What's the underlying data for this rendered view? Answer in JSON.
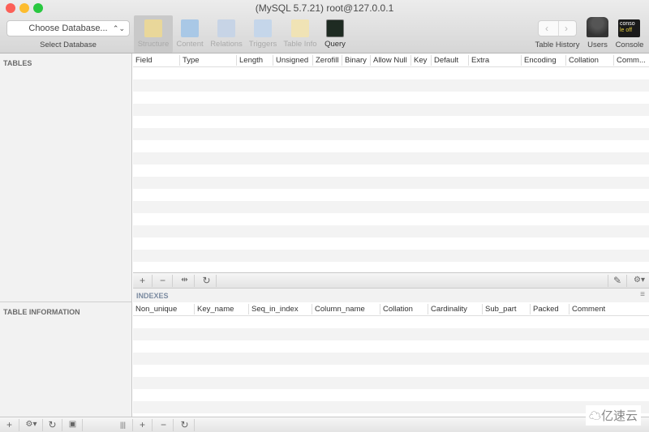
{
  "window": {
    "title": "(MySQL 5.7.21) root@127.0.0.1"
  },
  "toolbar": {
    "database_select": {
      "value": "Choose Database...",
      "label": "Select Database"
    },
    "items": [
      {
        "label": "Structure",
        "icon": "structure-icon",
        "active": true,
        "enabled": true
      },
      {
        "label": "Content",
        "icon": "content-icon",
        "enabled": false
      },
      {
        "label": "Relations",
        "icon": "relations-icon",
        "enabled": false
      },
      {
        "label": "Triggers",
        "icon": "triggers-icon",
        "enabled": false
      },
      {
        "label": "Table Info",
        "icon": "table-info-icon",
        "enabled": false
      },
      {
        "label": "Query",
        "icon": "query-icon",
        "enabled": true
      }
    ],
    "table_history": "Table History",
    "users": "Users",
    "console": "Console",
    "console_icon_text": "console off"
  },
  "sidebar": {
    "tables_header": "TABLES",
    "table_info_header": "TABLE INFORMATION"
  },
  "structure": {
    "columns": [
      "Field",
      "Type",
      "Length",
      "Unsigned",
      "Zerofill",
      "Binary",
      "Allow Null",
      "Key",
      "Default",
      "Extra",
      "Encoding",
      "Collation",
      "Comm..."
    ]
  },
  "indexes": {
    "title": "INDEXES",
    "columns": [
      "Non_unique",
      "Key_name",
      "Seq_in_index",
      "Column_name",
      "Collation",
      "Cardinality",
      "Sub_part",
      "Packed",
      "Comment"
    ]
  },
  "watermark": "亿速云"
}
